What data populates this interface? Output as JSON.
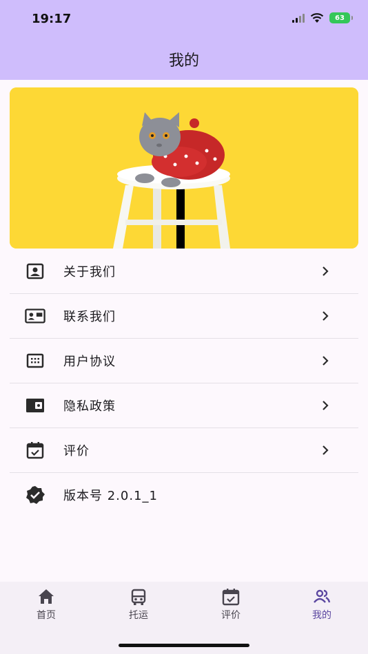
{
  "status_bar": {
    "time": "19:17",
    "battery": "63"
  },
  "app_bar": {
    "title": "我的"
  },
  "banner": {
    "image": "grey cat in red sweater on white stool, yellow background"
  },
  "menu": {
    "items": [
      {
        "label": "关于我们",
        "icon": "account-box-icon"
      },
      {
        "label": "联系我们",
        "icon": "contact-mail-icon"
      },
      {
        "label": "用户协议",
        "icon": "dialpad-grid-icon"
      },
      {
        "label": "隐私政策",
        "icon": "wallet-icon"
      },
      {
        "label": "评价",
        "icon": "calendar-check-icon"
      },
      {
        "label": "版本号 2.0.1_1",
        "icon": "verified-badge-icon"
      }
    ]
  },
  "bottom_nav": {
    "items": [
      {
        "label": "首页",
        "icon": "home-icon"
      },
      {
        "label": "托运",
        "icon": "car-icon"
      },
      {
        "label": "评价",
        "icon": "calendar-check-icon"
      },
      {
        "label": "我的",
        "icon": "people-icon",
        "active": true
      }
    ]
  },
  "colors": {
    "header": "#cfbdfc",
    "active": "#5b47a0",
    "banner_bg": "#fdd835"
  }
}
